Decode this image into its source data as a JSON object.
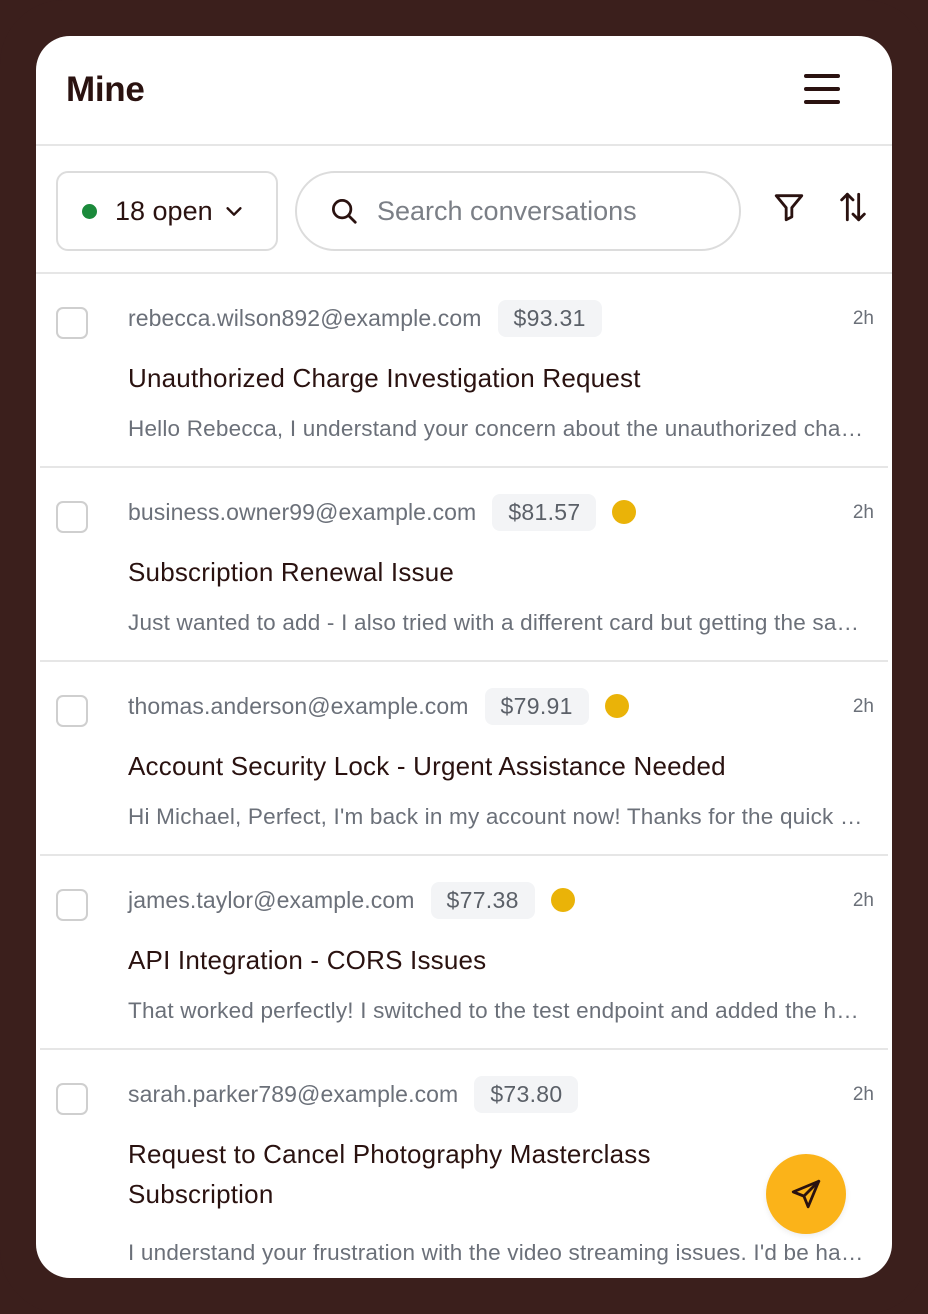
{
  "header": {
    "title": "Mine"
  },
  "toolbar": {
    "status_label": "18 open",
    "status_color": "#1b8a3b",
    "search_placeholder": "Search conversations"
  },
  "icons": {
    "menu": "hamburger-icon",
    "search": "search-icon",
    "filter": "filter-icon",
    "sort": "sort-icon",
    "send": "send-icon"
  },
  "colors": {
    "flag": "#eab308",
    "fab": "#fbb319",
    "frame": "#3b1f1c"
  },
  "conversations": [
    {
      "email": "rebecca.wilson892@example.com",
      "amount": "$93.31",
      "flagged": false,
      "time": "2h",
      "subject": "Unauthorized Charge Investigation Request",
      "preview": "Hello Rebecca, I understand your concern about the unauthorized charge on your account and want to assist"
    },
    {
      "email": "business.owner99@example.com",
      "amount": "$81.57",
      "flagged": true,
      "time": "2h",
      "subject": "Subscription Renewal Issue",
      "preview": "Just wanted to add - I also tried with a different card but getting the same error message each time"
    },
    {
      "email": "thomas.anderson@example.com",
      "amount": "$79.91",
      "flagged": true,
      "time": "2h",
      "subject": "Account Security Lock - Urgent Assistance Needed",
      "preview": "Hi Michael, Perfect, I'm back in my account now! Thanks for the quick help with unlocking everything"
    },
    {
      "email": "james.taylor@example.com",
      "amount": "$77.38",
      "flagged": true,
      "time": "2h",
      "subject": "API Integration - CORS Issues",
      "preview": "That worked perfectly! I switched to the test endpoint and added the headers you suggested"
    },
    {
      "email": "sarah.parker789@example.com",
      "amount": "$73.80",
      "flagged": false,
      "time": "2h",
      "subject": "Request to Cancel Photography Masterclass Subscription",
      "preview": "I understand your frustration with the video streaming issues. I'd be happy to help you cancel"
    }
  ]
}
